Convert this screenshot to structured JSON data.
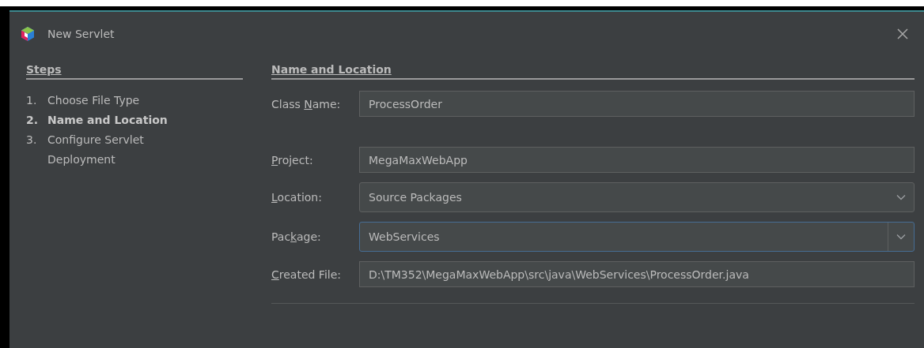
{
  "window": {
    "title": "New Servlet"
  },
  "steps": {
    "title": "Steps",
    "items": [
      {
        "number": "1.",
        "label": "Choose File Type",
        "selected": false
      },
      {
        "number": "2.",
        "label": "Name and Location",
        "selected": true
      },
      {
        "number": "3.",
        "label": "Configure Servlet Deployment",
        "selected": false
      }
    ]
  },
  "panel": {
    "title": "Name and Location",
    "fields": [
      {
        "label": {
          "before": "Class ",
          "key": "N",
          "after": "ame:"
        },
        "kind": "text",
        "value": "ProcessOrder",
        "focused": false
      },
      {
        "label": {
          "key": "P",
          "after": "roject:"
        },
        "kind": "text",
        "value": "MegaMaxWebApp",
        "focused": false
      },
      {
        "label": {
          "key": "L",
          "after": "ocation:"
        },
        "kind": "combo",
        "value": "Source Packages",
        "focused": false
      },
      {
        "label": {
          "before": "Pac",
          "key": "k",
          "after": "age:"
        },
        "kind": "editable-combo",
        "value": "WebServices",
        "focused": true
      },
      {
        "label": {
          "key": "C",
          "after": "reated File:"
        },
        "kind": "text",
        "value": "D:\\TM352\\MegaMaxWebApp\\src\\java\\WebServices\\ProcessOrder.java",
        "focused": false
      }
    ]
  }
}
